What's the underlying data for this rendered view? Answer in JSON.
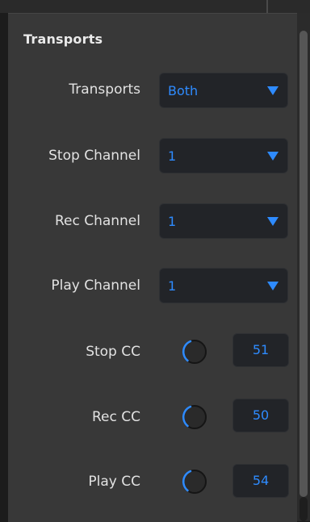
{
  "section": {
    "title": "Transports"
  },
  "rows": {
    "transports": {
      "label": "Transports",
      "value": "Both"
    },
    "stop_channel": {
      "label": "Stop Channel",
      "value": "1"
    },
    "rec_channel": {
      "label": "Rec Channel",
      "value": "1"
    },
    "play_channel": {
      "label": "Play Channel",
      "value": "1"
    },
    "stop_cc": {
      "label": "Stop CC",
      "value": "51"
    },
    "rec_cc": {
      "label": "Rec CC",
      "value": "50"
    },
    "play_cc": {
      "label": "Play CC",
      "value": "54"
    }
  },
  "colors": {
    "accent": "#2e8bff",
    "panel": "#383838",
    "field": "#222428"
  },
  "icons": {
    "dropdown": "caret-down-icon",
    "knob": "knob-icon"
  }
}
